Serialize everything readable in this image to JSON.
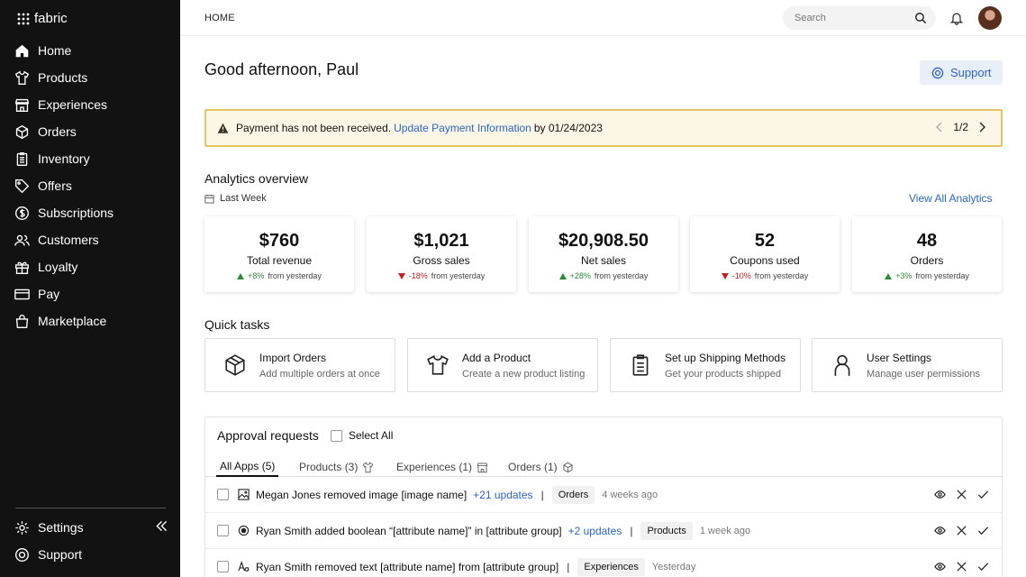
{
  "sidebar": {
    "brand": "fabric",
    "items": [
      {
        "label": "Home",
        "icon": "home-icon"
      },
      {
        "label": "Products",
        "icon": "shirt-icon"
      },
      {
        "label": "Experiences",
        "icon": "storefront-icon"
      },
      {
        "label": "Orders",
        "icon": "box-icon"
      },
      {
        "label": "Inventory",
        "icon": "clipboard-icon"
      },
      {
        "label": "Offers",
        "icon": "tag-icon"
      },
      {
        "label": "Subscriptions",
        "icon": "dollar-circle-icon"
      },
      {
        "label": "Customers",
        "icon": "users-icon"
      },
      {
        "label": "Loyalty",
        "icon": "gift-icon"
      },
      {
        "label": "Pay",
        "icon": "credit-card-icon"
      },
      {
        "label": "Marketplace",
        "icon": "shopping-bag-icon"
      }
    ],
    "bottom": [
      {
        "label": "Settings",
        "icon": "gear-icon"
      },
      {
        "label": "Support",
        "icon": "lifebuoy-icon"
      }
    ]
  },
  "header": {
    "breadcrumb": "HOME",
    "search_placeholder": "Search"
  },
  "greeting": "Good afternoon, Paul",
  "support_button": "Support",
  "alert": {
    "text_before": "Payment has not been received.",
    "link": "Update Payment Information",
    "text_after": "by 01/24/2023",
    "pager": "1/2"
  },
  "analytics": {
    "title": "Analytics overview",
    "period": "Last Week",
    "view_all": "View All Analytics",
    "stats": [
      {
        "value": "$760",
        "label": "Total revenue",
        "change": "+8%",
        "suffix": "from yesterday",
        "dir": "up"
      },
      {
        "value": "$1,021",
        "label": "Gross sales",
        "change": "-18%",
        "suffix": "from yesterday",
        "dir": "down"
      },
      {
        "value": "$20,908.50",
        "label": "Net sales",
        "change": "+28%",
        "suffix": "from yesterday",
        "dir": "up"
      },
      {
        "value": "52",
        "label": "Coupons used",
        "change": "-10%",
        "suffix": "from yesterday",
        "dir": "down"
      },
      {
        "value": "48",
        "label": "Orders",
        "change": "+3%",
        "suffix": "from yesterday",
        "dir": "up"
      }
    ]
  },
  "quick_tasks": {
    "title": "Quick tasks",
    "items": [
      {
        "title": "Import Orders",
        "sub": "Add multiple orders at once",
        "icon": "box-icon"
      },
      {
        "title": "Add a Product",
        "sub": "Create a new product listing",
        "icon": "shirt-icon"
      },
      {
        "title": "Set up Shipping Methods",
        "sub": "Get your products shipped",
        "icon": "clipboard-icon"
      },
      {
        "title": "User Settings",
        "sub": "Manage user permissions",
        "icon": "user-icon"
      }
    ]
  },
  "approvals": {
    "title": "Approval requests",
    "select_all": "Select All",
    "tabs": [
      {
        "label": "All Apps (5)"
      },
      {
        "label": "Products (3)",
        "icon": "shirt-icon"
      },
      {
        "label": "Experiences (1)",
        "icon": "storefront-icon"
      },
      {
        "label": "Orders (1)",
        "icon": "box-icon"
      }
    ],
    "rows": [
      {
        "icon": "image-icon",
        "user": "Megan Jones",
        "action": "removed image",
        "target": "[image name]",
        "mid": "",
        "group": "",
        "updates": "+21 updates",
        "app": "Orders",
        "time": "4 weeks ago"
      },
      {
        "icon": "radio-icon",
        "user": "Ryan Smith",
        "action": "added boolean “",
        "target": "[attribute name]",
        "mid": "” in",
        "group": "[attribute group]",
        "updates": "+2 updates",
        "app": "Products",
        "time": "1 week ago"
      },
      {
        "icon": "text-icon",
        "user": "Ryan Smith",
        "action": "removed text",
        "target": "[attribute name]",
        "mid": "from",
        "group": "[attribute group]",
        "updates": "",
        "app": "Experiences",
        "time": "Yesterday"
      }
    ]
  }
}
